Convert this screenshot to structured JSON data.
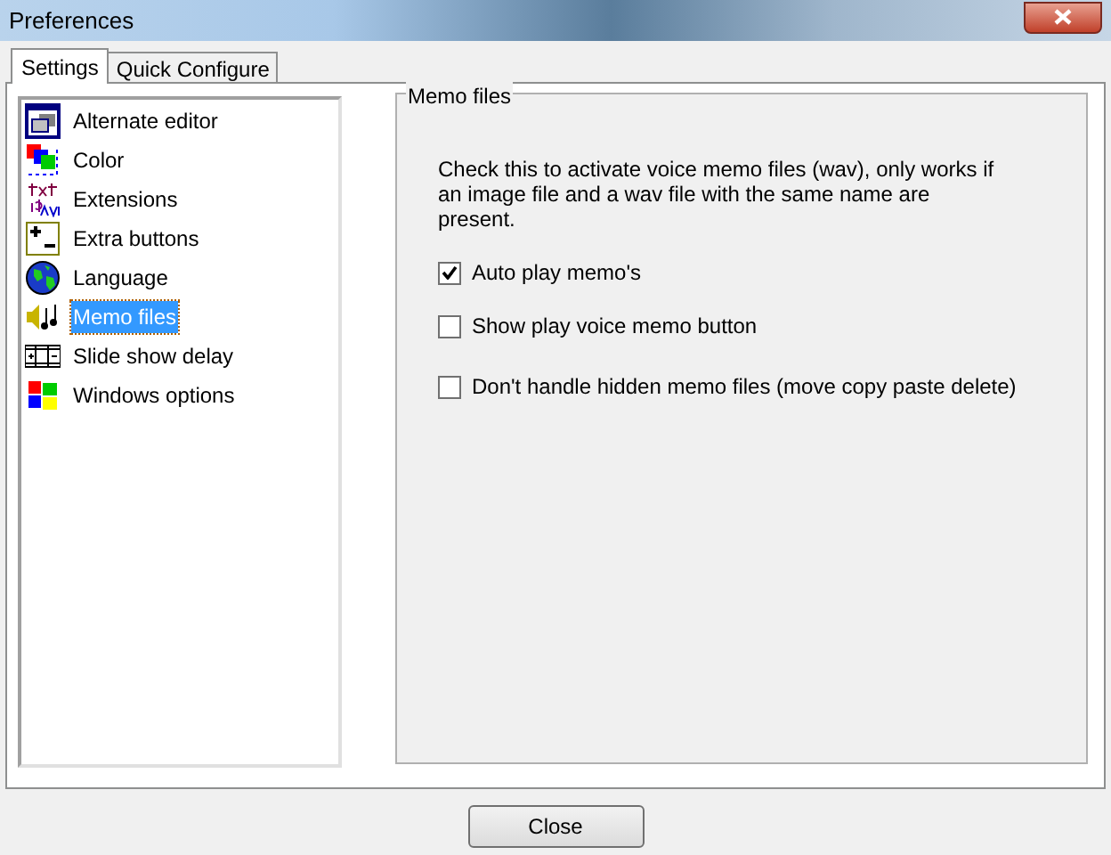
{
  "window": {
    "title": "Preferences"
  },
  "tabs": [
    {
      "label": "Settings",
      "selected": true
    },
    {
      "label": "Quick Configure",
      "selected": false
    }
  ],
  "sidebar": {
    "items": [
      {
        "label": "Alternate editor",
        "kind": "window",
        "selected": false
      },
      {
        "label": "Color",
        "kind": "color",
        "selected": false
      },
      {
        "label": "Extensions",
        "kind": "extensions",
        "selected": false
      },
      {
        "label": "Extra buttons",
        "kind": "plusminus",
        "selected": false
      },
      {
        "label": "Language",
        "kind": "globe",
        "selected": false
      },
      {
        "label": "Memo files",
        "kind": "sound",
        "selected": true
      },
      {
        "label": "Slide show delay",
        "kind": "film",
        "selected": false
      },
      {
        "label": "Windows options",
        "kind": "flag",
        "selected": false
      }
    ]
  },
  "group": {
    "title": "Memo files",
    "description": "Check this to activate voice memo files (wav), only works if an image file and a wav file with the same name are present.",
    "options": [
      {
        "label": "Auto play memo's",
        "checked": true
      },
      {
        "label": "Show play voice memo button",
        "checked": false
      },
      {
        "label": "Don't handle hidden memo files (move copy paste delete)",
        "checked": false
      }
    ]
  },
  "buttons": [
    {
      "label": "Close"
    }
  ]
}
